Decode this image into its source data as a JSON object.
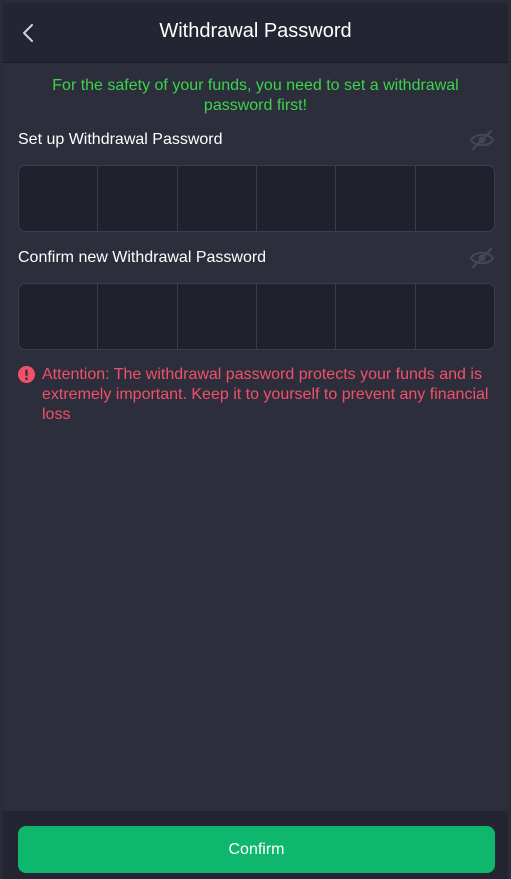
{
  "header": {
    "title": "Withdrawal Password",
    "back_icon": "chevron-left-icon"
  },
  "notice": "For the safety of your funds, you need to set a withdrawal password first!",
  "setup": {
    "label": "Set up Withdrawal Password",
    "eye_icon": "eye-closed-icon",
    "digits": [
      "",
      "",
      "",
      "",
      "",
      ""
    ]
  },
  "confirm_field": {
    "label": "Confirm new Withdrawal Password",
    "eye_icon": "eye-closed-icon",
    "digits": [
      "",
      "",
      "",
      "",
      "",
      ""
    ]
  },
  "attention": {
    "icon": "alert-icon",
    "text": "Attention: The withdrawal password protects your funds and is extremely important. Keep it to yourself to prevent any financial loss"
  },
  "footer": {
    "confirm_label": "Confirm"
  },
  "colors": {
    "accent_green": "#0eb76b",
    "notice_green": "#3cd44a",
    "warning_red": "#f2506a",
    "background": "#2c2e3c",
    "header_bg": "#232532"
  }
}
